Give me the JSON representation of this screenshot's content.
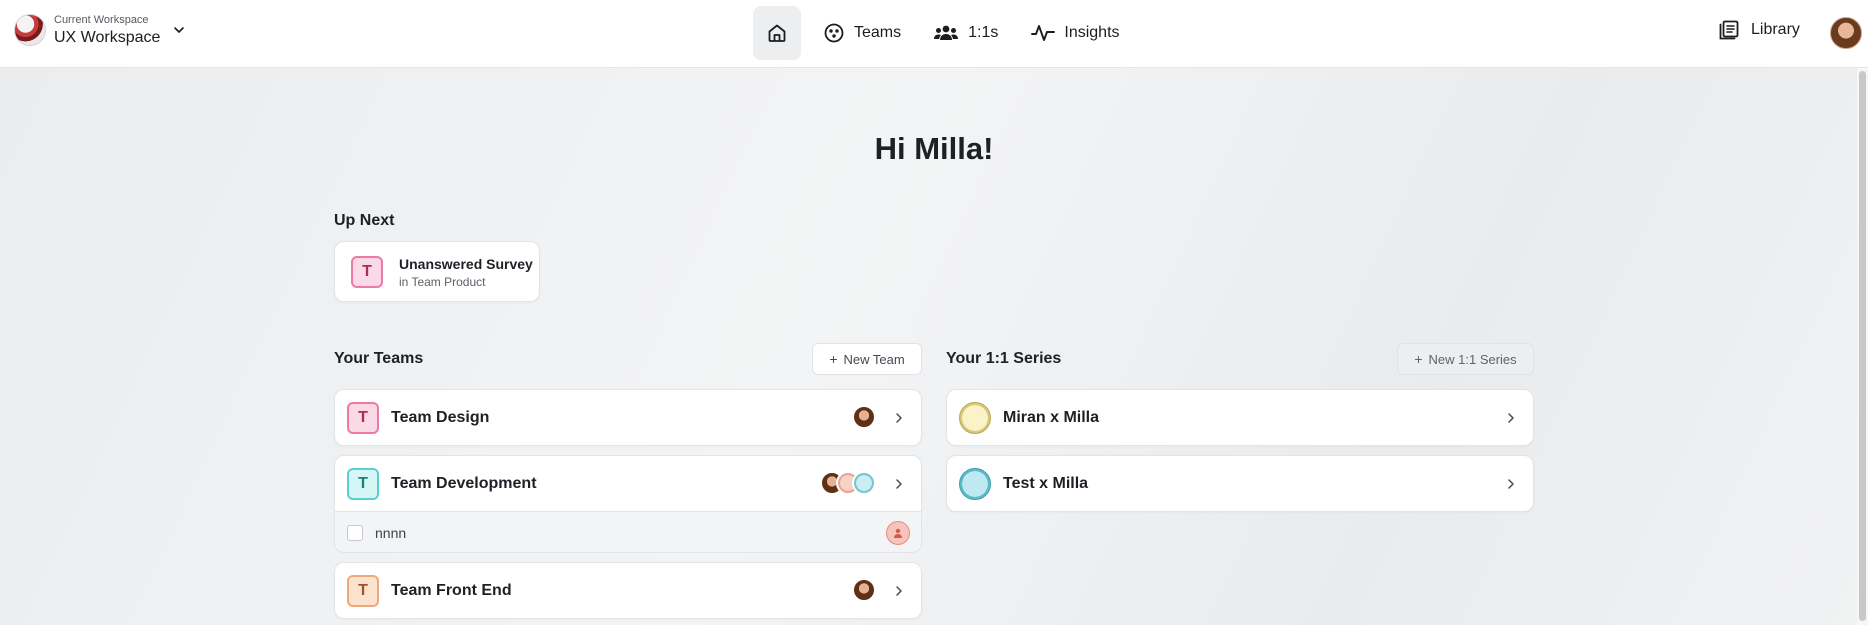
{
  "header": {
    "workspace_label": "Current Workspace",
    "workspace_name": "UX Workspace",
    "nav": {
      "teams": "Teams",
      "one_on_ones": "1:1s",
      "insights": "Insights"
    },
    "library": "Library"
  },
  "greeting": "Hi Milla!",
  "up_next": {
    "title": "Up Next",
    "item": {
      "badge": "T",
      "title": "Unanswered Survey",
      "subtitle": "in Team Product"
    }
  },
  "teams": {
    "title": "Your Teams",
    "new_button": "New Team",
    "items": [
      {
        "badge": "T",
        "name": "Team Design"
      },
      {
        "badge": "T",
        "name": "Team Development"
      },
      {
        "badge": "T",
        "name": "Team Front End"
      }
    ],
    "subtask": {
      "label": "nnnn"
    }
  },
  "series": {
    "title": "Your 1:1 Series",
    "new_button": "New 1:1 Series",
    "items": [
      {
        "name": "Miran x Milla"
      },
      {
        "name": "Test x Milla"
      }
    ]
  },
  "colors": {
    "badge_pink": "#ec7aa4",
    "badge_teal": "#57d1cd",
    "badge_peach": "#f0a878",
    "nav_active_bg": "#eceef0"
  },
  "icons": {
    "workspace": "workspace-logo",
    "home": "home-icon",
    "teams": "teams-icon",
    "one_on_ones": "people-icon",
    "insights": "pulse-icon",
    "library": "library-icon"
  }
}
